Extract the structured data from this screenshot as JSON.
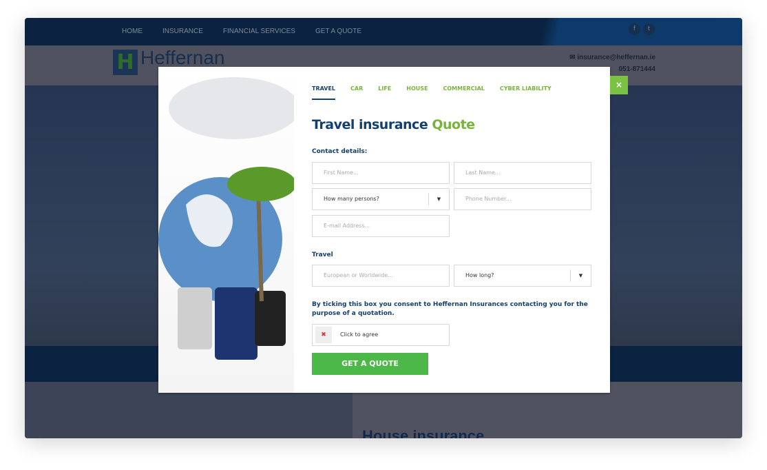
{
  "nav": {
    "items": [
      "HOME",
      "INSURANCE",
      "FINANCIAL SERVICES",
      "GET A QUOTE"
    ],
    "social": [
      "facebook-icon",
      "twitter-icon"
    ]
  },
  "header": {
    "brand": "Heffernan",
    "email": "insurance@heffernan.ie",
    "phone": "051-871444"
  },
  "background": {
    "section_title": "House insurance"
  },
  "modal": {
    "tabs": [
      "TRAVEL",
      "CAR",
      "LIFE",
      "HOUSE",
      "COMMERCIAL",
      "CYBER LIABILITY"
    ],
    "active_tab": "TRAVEL",
    "title_main": "Travel insurance",
    "title_accent": "Quote",
    "contact_label": "Contact details:",
    "first_name": "First Name...",
    "last_name": "Last Name...",
    "persons": "How many persons?",
    "phone": "Phone Number...",
    "email": "E-mail Address...",
    "travel_label": "Travel",
    "region": "European or Worldwide...",
    "duration": "How long?",
    "consent": "By ticking this box you consent to Heffernan Insurances contacting you for the purpose of a quotation.",
    "agree": "Click to agree",
    "submit": "GET A QUOTE",
    "close": "×"
  },
  "colors": {
    "navy": "#123f6e",
    "green": "#76b43a",
    "button": "#4cb848"
  }
}
